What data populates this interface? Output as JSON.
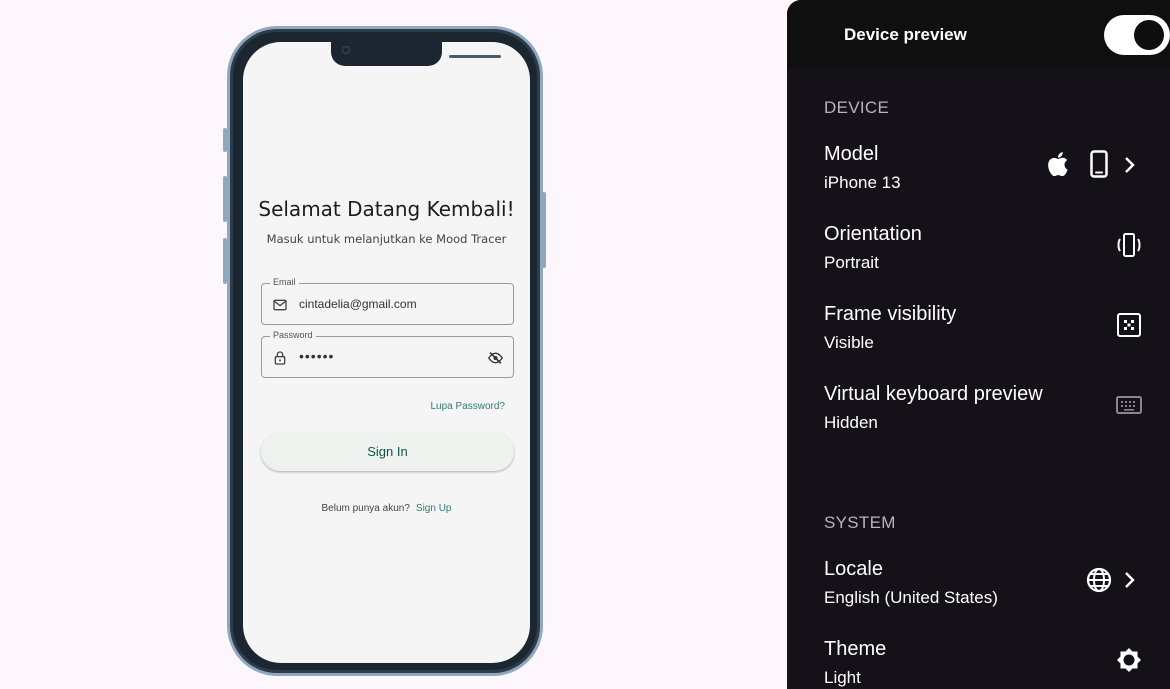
{
  "app": {
    "title": "Selamat Datang Kembali!",
    "subtitle": "Masuk untuk melanjutkan ke Mood Tracer",
    "email": {
      "label": "Email",
      "value": "cintadelia@gmail.com",
      "icon": "mail-icon"
    },
    "password": {
      "label": "Password",
      "value": "••••••",
      "icon": "lock-icon",
      "toggle_icon": "visibility-off-icon"
    },
    "forgot_label": "Lupa Password?",
    "signin_label": "Sign In",
    "no_account_text": "Belum punya akun?",
    "signup_label": "Sign Up",
    "accent_color": "#2e7d74"
  },
  "panel": {
    "title": "Device preview",
    "enabled": true,
    "device_section": "DEVICE",
    "model": {
      "title": "Model",
      "value": "iPhone 13",
      "icons": [
        "apple-icon",
        "phone-icon",
        "chevron-right-icon"
      ]
    },
    "orientation": {
      "title": "Orientation",
      "value": "Portrait",
      "icon": "screen-rotation-icon"
    },
    "frame": {
      "title": "Frame visibility",
      "value": "Visible",
      "icon": "frame-icon"
    },
    "keyboard": {
      "title": "Virtual keyboard preview",
      "value": "Hidden",
      "icon": "keyboard-icon"
    },
    "system_section": "SYSTEM",
    "locale": {
      "title": "Locale",
      "value": "English (United States)",
      "icons": [
        "globe-icon",
        "chevron-right-icon"
      ]
    },
    "theme": {
      "title": "Theme",
      "value": "Light",
      "icon": "brightness-icon"
    }
  }
}
